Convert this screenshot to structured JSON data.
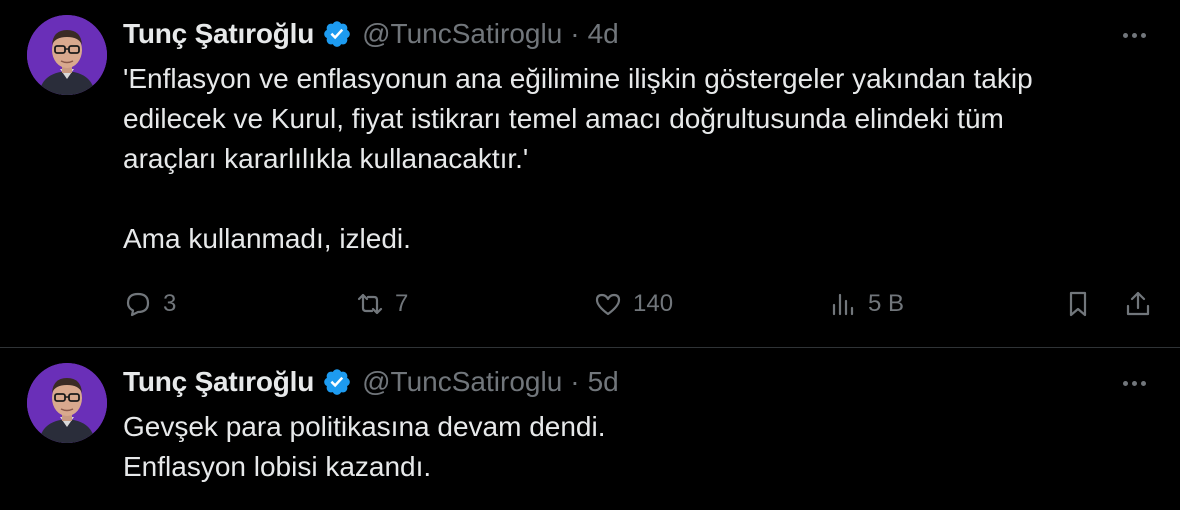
{
  "tweets": [
    {
      "author_name": "Tunç Şatıroğlu",
      "handle": "@TuncSatiroglu",
      "separator": "·",
      "time": "4d",
      "text": "'Enflasyon ve enflasyonun ana eğilimine ilişkin göstergeler yakından takip\nedilecek ve Kurul, fiyat istikrarı temel amacı doğrultusunda elindeki tüm\naraçları kararlılıkla kullanacaktır.'\n\nAma kullanmadı, izledi.",
      "replies": "3",
      "retweets": "7",
      "likes": "140",
      "views": "5 B"
    },
    {
      "author_name": "Tunç Şatıroğlu",
      "handle": "@TuncSatiroglu",
      "separator": "·",
      "time": "5d",
      "text": "Gevşek para politikasına devam dendi.\nEnflasyon lobisi kazandı."
    }
  ],
  "icons": {
    "verified": "verified-badge-icon",
    "more": "more-horizontal-icon",
    "reply": "reply-icon",
    "retweet": "retweet-icon",
    "like": "heart-icon",
    "views": "views-chart-icon",
    "bookmark": "bookmark-icon",
    "share": "share-icon"
  },
  "colors": {
    "background": "#000000",
    "text": "#e7e9ea",
    "muted": "#71767b",
    "verified": "#1d9bf0",
    "divider": "#2f3336"
  }
}
